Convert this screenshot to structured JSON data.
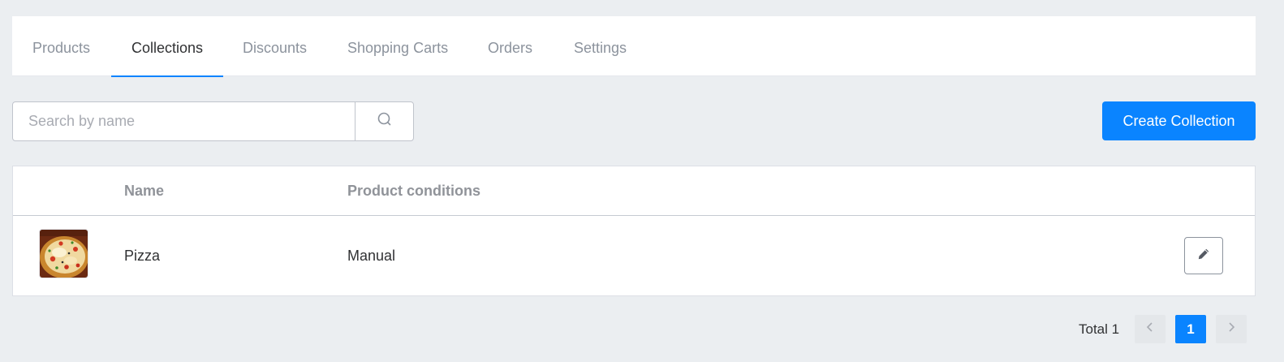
{
  "tabs": [
    {
      "label": "Products",
      "active": false
    },
    {
      "label": "Collections",
      "active": true
    },
    {
      "label": "Discounts",
      "active": false
    },
    {
      "label": "Shopping Carts",
      "active": false
    },
    {
      "label": "Orders",
      "active": false
    },
    {
      "label": "Settings",
      "active": false
    }
  ],
  "search": {
    "placeholder": "Search by name",
    "value": "",
    "icon": "search-icon"
  },
  "actions": {
    "create_label": "Create Collection"
  },
  "table": {
    "columns": [
      "",
      "Name",
      "Product conditions",
      ""
    ],
    "rows": [
      {
        "thumbnail": "pizza-image",
        "name": "Pizza",
        "conditions": "Manual",
        "action_icon": "pencil-icon"
      }
    ]
  },
  "pagination": {
    "total_label": "Total 1",
    "current_page": "1",
    "prev_icon": "chevron-left-icon",
    "next_icon": "chevron-right-icon"
  },
  "colors": {
    "accent": "#0a84ff",
    "background": "#ebeef1",
    "muted_text": "#8c939d"
  }
}
